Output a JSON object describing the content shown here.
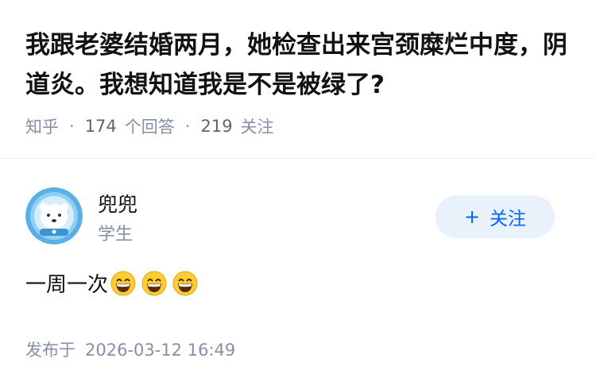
{
  "question": {
    "title": "我跟老婆结婚两月，她检查出来宫颈糜烂中度，阴道炎。我想知道我是不是被绿了?",
    "source": "知乎",
    "answer_count": "174",
    "answer_label": "个回答",
    "follower_count": "219",
    "follower_label": "关注"
  },
  "author": {
    "name": "兜兜",
    "headline": "学生",
    "avatar_icon": "polar-bear-astronaut-avatar",
    "follow_label": "关注",
    "follow_icon": "plus-icon"
  },
  "answer": {
    "text": "一周一次",
    "emojis": [
      "grinning-face-emoji",
      "grinning-face-emoji",
      "grinning-face-emoji"
    ],
    "published_label": "发布于",
    "published_time": "2026-03-12 16:49"
  },
  "colors": {
    "brand": "#0066ff",
    "follow_bg": "#e9f1fb",
    "meta_text": "#8590a6",
    "title_text": "#121212"
  }
}
